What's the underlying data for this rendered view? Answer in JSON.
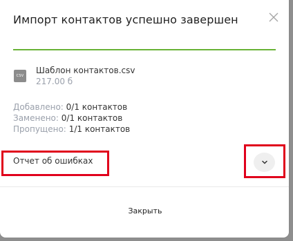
{
  "dialog": {
    "title": "Импорт контактов успешно завершен",
    "progress_percent": 100,
    "accent_color": "#67b235"
  },
  "file": {
    "icon": "csv-file-icon",
    "icon_label": "CSV",
    "name": "Шаблон контактов.csv",
    "size": "217.00 б"
  },
  "stats": [
    {
      "label": "Добавлено:",
      "value": "0/1 контактов"
    },
    {
      "label": "Заменено:",
      "value": "0/1 контактов"
    },
    {
      "label": "Пропущено:",
      "value": "1/1 контактов"
    }
  ],
  "errors_report": {
    "label": "Отчет об ошибках",
    "expand_icon": "chevron-down-icon",
    "highlight_color": "#e0001b"
  },
  "footer": {
    "close_label": "Закрыть"
  }
}
